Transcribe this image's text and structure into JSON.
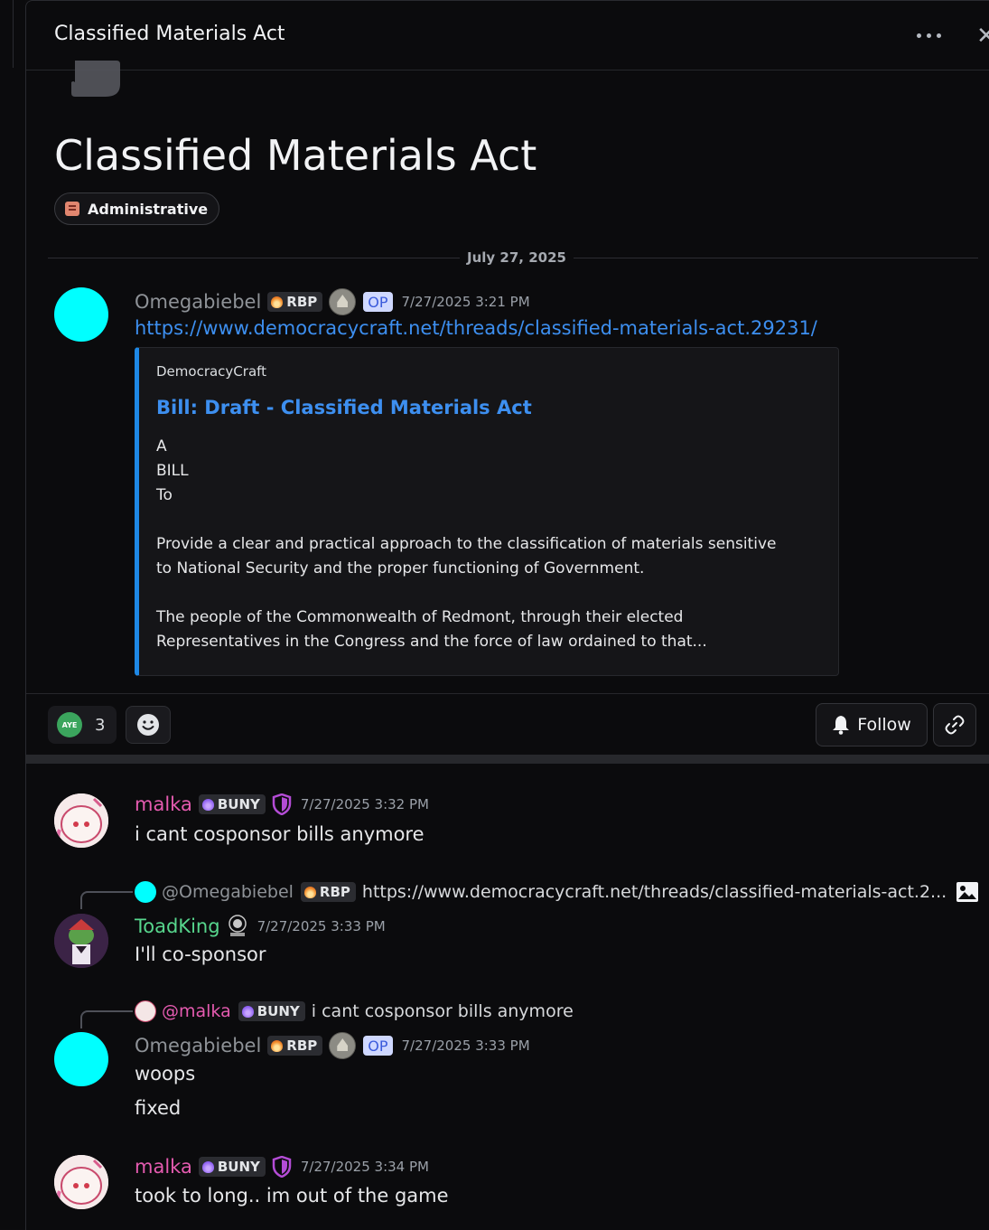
{
  "header": {
    "title": "Classified Materials Act"
  },
  "post": {
    "title": "Classified Materials Act",
    "tag": "Administrative",
    "date_divider": "July 27, 2025"
  },
  "messages": {
    "op": {
      "username": "Omegabiebel",
      "badge": "RBP",
      "op_label": "OP",
      "timestamp": "7/27/2025 3:21 PM",
      "link": "https://www.democracycraft.net/threads/classified-materials-act.29231/",
      "embed": {
        "provider": "DemocracyCraft",
        "title": "Bill: Draft - Classified Materials Act",
        "description": "A\nBILL\nTo\n\nProvide a clear and practical approach to the classification of materials sensitive\nto National Security and the proper functioning of Government.\n\nThe people of the Commonwealth of Redmont, through their elected\nRepresentatives in the Congress and the force of law ordained to that..."
      }
    },
    "m1": {
      "username": "malka",
      "badge": "BUNY",
      "timestamp": "7/27/2025 3:32 PM",
      "text": "i cant cosponsor bills anymore"
    },
    "m2": {
      "reply_to": "@Omegabiebel",
      "reply_badge": "RBP",
      "reply_text": "https://www.democracycraft.net/threads/classified-materials-act.2...",
      "username": "ToadKing",
      "timestamp": "7/27/2025 3:33 PM",
      "text": "I'll co-sponsor"
    },
    "m3": {
      "reply_to": "@malka",
      "reply_badge": "BUNY",
      "reply_text": "i cant cosponsor bills anymore",
      "username": "Omegabiebel",
      "badge": "RBP",
      "op_label": "OP",
      "timestamp": "7/27/2025 3:33 PM",
      "text1": "woops",
      "text2": "fixed"
    },
    "m4": {
      "username": "malka",
      "badge": "BUNY",
      "timestamp": "7/27/2025 3:34 PM",
      "text": "took to long.. im out of the game"
    }
  },
  "actions": {
    "reaction_label": "AYE",
    "reaction_count": "3",
    "follow_label": "Follow"
  },
  "colors": {
    "accent_link": "#3d8ff0",
    "op_name": "#8e9297",
    "malka": "#e55bb0",
    "toadking": "#57d68d",
    "avatar_cyan": "#00ffff"
  },
  "icons": [
    "more-icon",
    "close-icon",
    "chat-bubble-icon",
    "tag-icon",
    "aye-emoji",
    "add-reaction-icon",
    "bell-icon",
    "link-icon",
    "image-icon",
    "shield-icon",
    "capitol-icon"
  ]
}
